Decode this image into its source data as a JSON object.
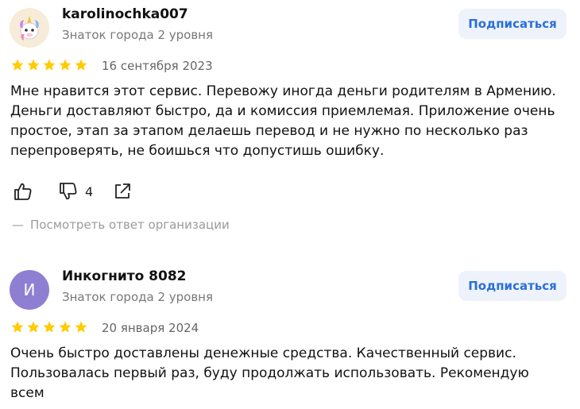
{
  "colors": {
    "star": "#ffcc00",
    "subscribe_bg": "#eef3fb",
    "subscribe_text": "#2b6fd8",
    "avatar_letter_bg": "#8f7fd2",
    "muted_text": "#777777"
  },
  "reviews": [
    {
      "author": "karolinochka007",
      "level": "Знаток города 2 уровня",
      "avatar_icon": "unicorn-avatar-icon",
      "subscribe_label": "Подписаться",
      "rating": 5,
      "date": "16 сентября 2023",
      "text": "Мне нравится этот сервис. Перевожу иногда деньги родителям в Армению. Деньги доставляют быстро, да и комиссия приемлемая. Приложение очень простое, этап за этапом делаешь перевод и не нужно по несколько раз перепроверять, не боишься что допустишь ошибку.",
      "dislike_count": "4",
      "org_answer_label": "Посмотреть ответ организации",
      "org_answer_dash": "—"
    },
    {
      "author": "Инкогнито 8082",
      "level": "Знаток города 2 уровня",
      "avatar_letter": "И",
      "subscribe_label": "Подписаться",
      "rating": 5,
      "date": "20 января 2024",
      "text": "Очень быстро доставлены денежные средства. Качественный сервис. Пользовалась первый раз, буду продолжать использовать. Рекомендую всем"
    }
  ]
}
